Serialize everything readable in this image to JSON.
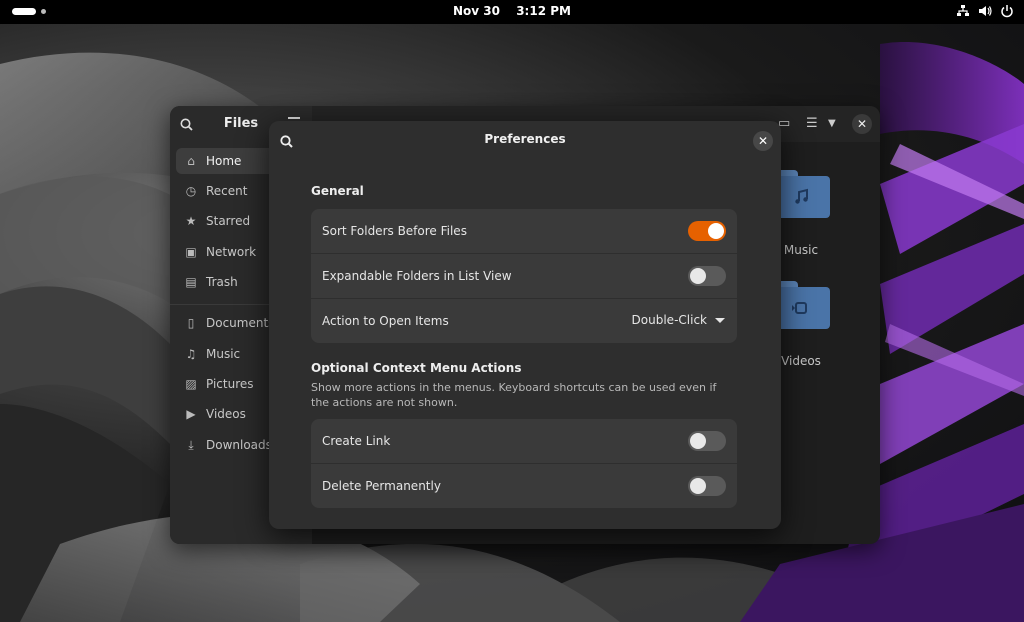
{
  "topbar": {
    "date": "Nov 30",
    "time": "3:12 PM",
    "icons": [
      "network-icon",
      "volume-icon",
      "power-icon"
    ]
  },
  "files": {
    "title": "Files",
    "sidebar": [
      {
        "label": "Home",
        "icon": "home-icon",
        "active": true
      },
      {
        "label": "Recent",
        "icon": "clock-icon"
      },
      {
        "label": "Starred",
        "icon": "star-icon"
      },
      {
        "label": "Network",
        "icon": "network-icon"
      },
      {
        "label": "Trash",
        "icon": "trash-icon"
      },
      {
        "label": "Documents",
        "icon": "document-icon"
      },
      {
        "label": "Music",
        "icon": "music-icon"
      },
      {
        "label": "Pictures",
        "icon": "picture-icon"
      },
      {
        "label": "Videos",
        "icon": "video-icon"
      },
      {
        "label": "Downloads",
        "icon": "download-icon"
      }
    ],
    "folders": [
      {
        "label": "Music",
        "icon": "music-note-icon"
      },
      {
        "label": "Videos",
        "icon": "video-camera-icon"
      }
    ]
  },
  "preferences": {
    "title": "Preferences",
    "general": {
      "title": "General",
      "rows": [
        {
          "label": "Sort Folders Before Files",
          "type": "switch",
          "on": true
        },
        {
          "label": "Expandable Folders in List View",
          "type": "switch",
          "on": false
        },
        {
          "label": "Action to Open Items",
          "type": "dropdown",
          "value": "Double-Click"
        }
      ]
    },
    "context": {
      "title": "Optional Context Menu Actions",
      "description": "Show more actions in the menus. Keyboard shortcuts can be used even if the actions are not shown.",
      "rows": [
        {
          "label": "Create Link",
          "type": "switch",
          "on": false
        },
        {
          "label": "Delete Permanently",
          "type": "switch",
          "on": false
        }
      ]
    }
  },
  "colors": {
    "accent": "#e66100",
    "folder": "#4a74a8",
    "dialog_bg": "#2e2e2e",
    "row_bg": "#3a3a3a"
  }
}
